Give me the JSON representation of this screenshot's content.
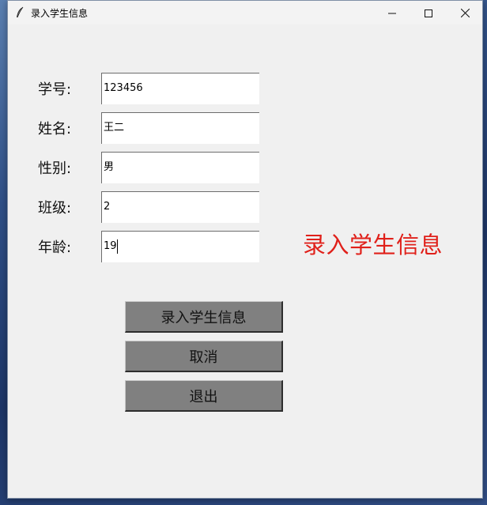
{
  "window": {
    "title": "录入学生信息",
    "controls": {
      "minimize_icon": "minimize-icon",
      "maximize_icon": "maximize-icon",
      "close_icon": "close-icon"
    }
  },
  "form": {
    "fields": [
      {
        "label": "学号:",
        "value": "123456"
      },
      {
        "label": "姓名:",
        "value": "王二"
      },
      {
        "label": "性别:",
        "value": "男"
      },
      {
        "label": "班级:",
        "value": "2"
      },
      {
        "label": "年龄:",
        "value": "19"
      }
    ]
  },
  "banner": {
    "text": "录入学生信息",
    "color": "#e0201a"
  },
  "buttons": {
    "submit": "录入学生信息",
    "cancel": "取消",
    "exit": "退出"
  }
}
